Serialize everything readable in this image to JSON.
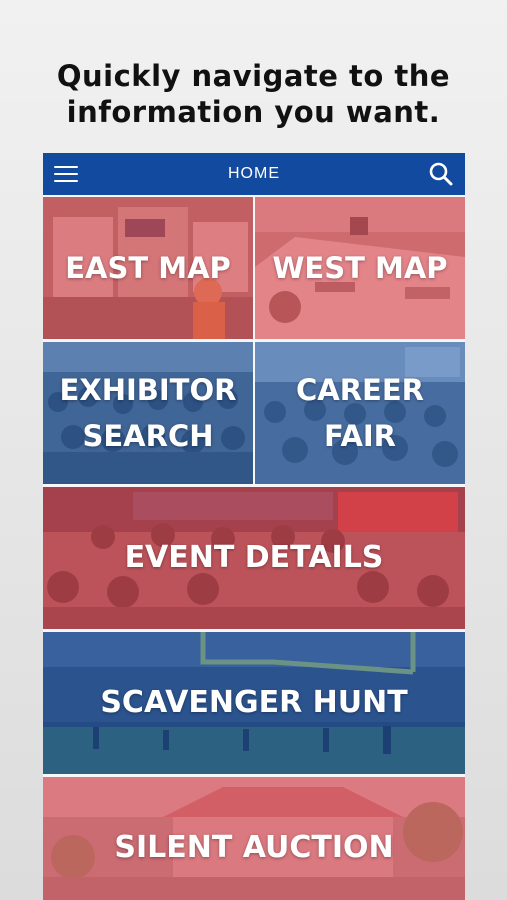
{
  "promo": {
    "headline": "Quickly navigate to the\ninformation you want."
  },
  "navbar": {
    "title": "HOME",
    "menu_icon": "hamburger-menu-icon",
    "search_icon": "search-icon",
    "background_color": "#114a9e"
  },
  "tiles": [
    {
      "label": "EAST MAP",
      "tint": "red"
    },
    {
      "label": "WEST MAP",
      "tint": "red"
    },
    {
      "label": "EXHIBITOR\nSEARCH",
      "tint": "blue"
    },
    {
      "label": "CAREER\nFAIR",
      "tint": "blue"
    },
    {
      "label": "EVENT DETAILS",
      "tint": "red"
    },
    {
      "label": "SCAVENGER HUNT",
      "tint": "blue"
    },
    {
      "label": "SILENT AUCTION",
      "tint": "red"
    }
  ]
}
